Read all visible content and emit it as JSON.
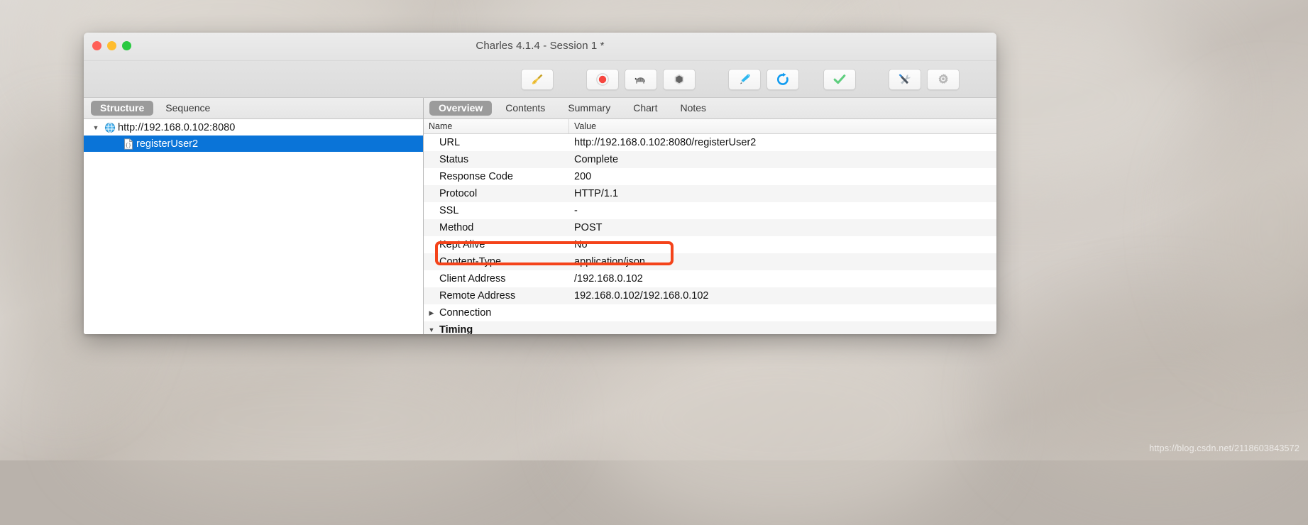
{
  "window": {
    "title": "Charles 4.1.4 - Session 1 *",
    "traffic_lights": {
      "close_label": "Close",
      "minimize_label": "Minimize",
      "maximize_label": "Maximize"
    },
    "colors": {
      "close": "#ff5f57",
      "minimize": "#ffbd2e",
      "maximize": "#28c940",
      "selection": "#0a74d8",
      "annotation": "#f4431a",
      "active_tab": "#9b9b9b"
    }
  },
  "toolbar": {
    "buttons": [
      {
        "name": "clear-session-button",
        "icon": "broom-icon",
        "label": "Clear Session"
      },
      {
        "name": "start-stop-recording-button",
        "icon": "record-icon",
        "label": "Start/Stop Recording"
      },
      {
        "name": "throttle-button",
        "icon": "turtle-icon",
        "label": "Start/Stop Throttling"
      },
      {
        "name": "breakpoints-button",
        "icon": "hexagon-icon",
        "label": "Enable/Disable Breakpoints"
      },
      {
        "name": "compose-button",
        "icon": "pen-icon",
        "label": "Compose"
      },
      {
        "name": "repeat-button",
        "icon": "refresh-icon",
        "label": "Repeat"
      },
      {
        "name": "validate-button",
        "icon": "checkmark-icon",
        "label": "Validate"
      },
      {
        "name": "tools-button",
        "icon": "tools-icon",
        "label": "Tools"
      },
      {
        "name": "settings-button",
        "icon": "gear-icon",
        "label": "Settings"
      }
    ]
  },
  "left_pane": {
    "tabs": [
      {
        "label": "Structure",
        "active": true
      },
      {
        "label": "Sequence",
        "active": false
      }
    ],
    "tree": [
      {
        "label": "http://192.168.0.102:8080",
        "icon": "globe-icon",
        "disclosure": "▼",
        "level": 0,
        "selected": false
      },
      {
        "label": "registerUser2",
        "icon": "json-document-icon",
        "disclosure": "",
        "level": 1,
        "selected": true
      }
    ]
  },
  "right_pane": {
    "tabs": [
      {
        "label": "Overview",
        "active": true
      },
      {
        "label": "Contents",
        "active": false
      },
      {
        "label": "Summary",
        "active": false
      },
      {
        "label": "Chart",
        "active": false
      },
      {
        "label": "Notes",
        "active": false
      }
    ],
    "table": {
      "columns": [
        "Name",
        "Value"
      ],
      "rows": [
        {
          "name": "URL",
          "value": "http://192.168.0.102:8080/registerUser2",
          "disclosure": "",
          "group": false
        },
        {
          "name": "Status",
          "value": "Complete",
          "disclosure": "",
          "group": false
        },
        {
          "name": "Response Code",
          "value": "200",
          "disclosure": "",
          "group": false
        },
        {
          "name": "Protocol",
          "value": "HTTP/1.1",
          "disclosure": "",
          "group": false
        },
        {
          "name": "SSL",
          "value": "-",
          "disclosure": "",
          "group": false
        },
        {
          "name": "Method",
          "value": "POST",
          "disclosure": "",
          "group": false
        },
        {
          "name": "Kept Alive",
          "value": "No",
          "disclosure": "",
          "group": false
        },
        {
          "name": "Content-Type",
          "value": "application/json",
          "disclosure": "",
          "group": false
        },
        {
          "name": "Client Address",
          "value": "/192.168.0.102",
          "disclosure": "",
          "group": false
        },
        {
          "name": "Remote Address",
          "value": "192.168.0.102/192.168.0.102",
          "disclosure": "",
          "group": false
        },
        {
          "name": "Connection",
          "value": "",
          "disclosure": "▶",
          "group": false
        },
        {
          "name": "Timing",
          "value": "",
          "disclosure": "▼",
          "group": true
        }
      ]
    }
  },
  "annotation": {
    "target_row": "Content-Type",
    "shape": "rounded-rectangle"
  },
  "watermark": {
    "text": "https://blog.csdn.net/2118603843572"
  }
}
